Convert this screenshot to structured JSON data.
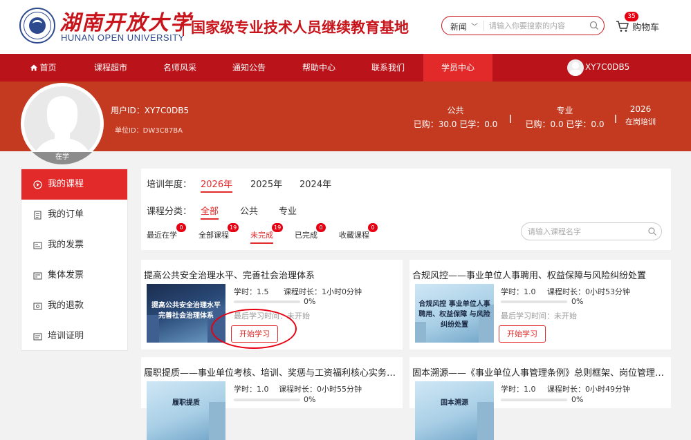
{
  "header": {
    "logo_cn": "湖南开放大学",
    "logo_en": "HUNAN OPEN UNIVERSITY",
    "slogan": "国家级专业技术人员继续教育基地",
    "search_category": "新闻",
    "search_placeholder": "请输入你要搜索的内容",
    "cart_label": "购物车",
    "cart_count": "35"
  },
  "nav": {
    "items": [
      "首页",
      "课程超市",
      "名师风采",
      "通知公告",
      "帮助中心",
      "联系我们",
      "学员中心"
    ],
    "active_index": 6,
    "username": "XY7C0DB5"
  },
  "profile": {
    "user_id": "用户ID：XY7C0DB5",
    "unit_id": "单位ID：DW3C87BA",
    "status": "在学",
    "stats": [
      {
        "title": "公共",
        "value": "已购：30.0 已学：0.0"
      },
      {
        "title": "专业",
        "value": "已购：0.0 已学：0.0"
      },
      {
        "title": "2026",
        "value": "在岗培训"
      }
    ]
  },
  "sidebar": {
    "items": [
      {
        "label": "我的课程",
        "icon": "play-circle-icon"
      },
      {
        "label": "我的订单",
        "icon": "order-list-icon"
      },
      {
        "label": "我的发票",
        "icon": "invoice-icon"
      },
      {
        "label": "集体发票",
        "icon": "group-invoice-icon"
      },
      {
        "label": "我的退款",
        "icon": "refund-icon"
      },
      {
        "label": "培训证明",
        "icon": "certificate-icon"
      }
    ],
    "active_index": 0
  },
  "filters": {
    "year_label": "培训年度：",
    "years": [
      "2026年",
      "2025年",
      "2024年"
    ],
    "active_year": 0,
    "category_label": "课程分类：",
    "categories": [
      "全部",
      "公共",
      "专业"
    ],
    "active_category": 0,
    "status_tabs": [
      {
        "label": "最近在学",
        "count": "0"
      },
      {
        "label": "全部课程",
        "count": "19"
      },
      {
        "label": "未完成",
        "count": "19"
      },
      {
        "label": "已完成",
        "count": "0"
      },
      {
        "label": "收藏课程",
        "count": "0"
      }
    ],
    "active_status": 2,
    "search_placeholder": "请输入课程名字"
  },
  "courses": [
    {
      "title": "提高公共安全治理水平、完善社会治理体系",
      "thumb_text": "提高公共安全治理水平 完善社会治理体系",
      "hours": "学时：1.5",
      "duration": "课程时长：1小时0分钟",
      "progress": 0,
      "progress_label": "0%",
      "last_study": "最后学习时间：未开始",
      "button": "开始学习"
    },
    {
      "title": "合规风控——事业单位人事聘用、权益保障与风险纠纷处置",
      "thumb_text": "合规风控 事业单位人事聘用、权益保障 与风险纠纷处置",
      "hours": "学时：1.0",
      "duration": "课程时长：0小时53分钟",
      "progress": 0,
      "progress_label": "0%",
      "last_study": "最后学习时间：未开始",
      "button": "开始学习"
    },
    {
      "title": "履职提质——事业单位考核、培训、奖惩与工资福利核心实务解读",
      "thumb_text": "履职提质",
      "hours": "学时：1.0",
      "duration": "课程时长：0小时55分钟",
      "progress": 0,
      "progress_label": "0%"
    },
    {
      "title": "固本溯源——《事业单位人事管理条例》总则框架、岗位管理与…",
      "thumb_text": "固本溯源",
      "hours": "学时：1.0",
      "duration": "课程时长：0小时49分钟",
      "progress": 0,
      "progress_label": "0%"
    }
  ],
  "colors": {
    "brand_red": "#ba1319",
    "accent_red": "#e22a2a",
    "banner_red": "#c33a20",
    "logo_blue": "#2d4a8f"
  }
}
